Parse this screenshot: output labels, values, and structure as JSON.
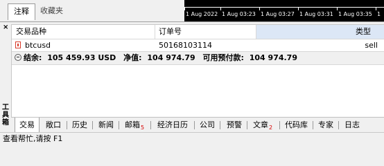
{
  "top_tabs": {
    "active": "注释",
    "inactive": "收藏夹"
  },
  "chart_axis": {
    "labels": [
      "1 Aug 2022",
      "1 Aug 03:23",
      "1 Aug 03:27",
      "1 Aug 03:31",
      "1 Aug 03:35",
      "1"
    ]
  },
  "toolbox": {
    "title": "工具箱",
    "close_glyph": "×",
    "columns": {
      "symbol": "交易品种",
      "order": "订单号",
      "type": "类型"
    },
    "rows": [
      {
        "symbol": "btcusd",
        "order": "50168103114",
        "type": "sell"
      }
    ],
    "summary": {
      "balance_label": "结余:",
      "balance_value": "105 459.93 USD",
      "equity_label": "净值:",
      "equity_value": "104 974.79",
      "margin_label": "可用预付款:",
      "margin_value": "104 974.79"
    },
    "tabs": [
      {
        "label": "交易"
      },
      {
        "label": "敞口"
      },
      {
        "label": "历史"
      },
      {
        "label": "新闻"
      },
      {
        "label": "邮箱",
        "badge": "5"
      },
      {
        "label": "经济日历"
      },
      {
        "label": "公司"
      },
      {
        "label": "预警"
      },
      {
        "label": "文章",
        "badge": "2"
      },
      {
        "label": "代码库"
      },
      {
        "label": "专家"
      },
      {
        "label": "日志"
      }
    ]
  },
  "status_bar": {
    "text": "查看帮忙,请按 F1"
  }
}
